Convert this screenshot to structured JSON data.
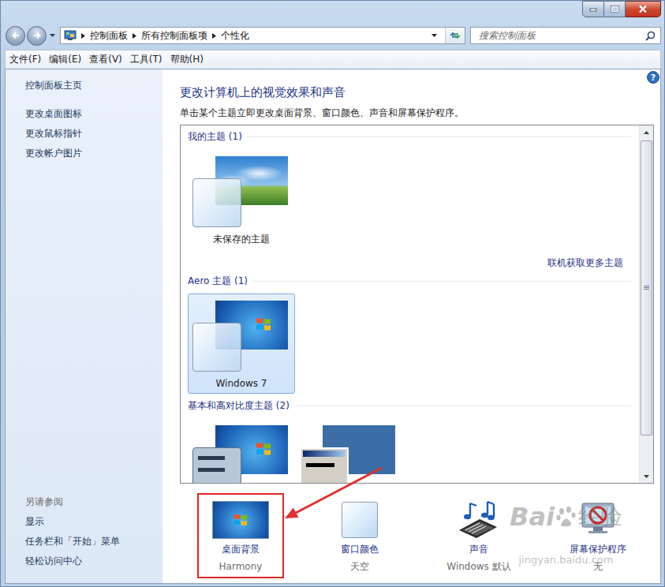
{
  "address_bar": {
    "breadcrumb": [
      "控制面板",
      "所有控制面板项",
      "个性化"
    ]
  },
  "search": {
    "placeholder": "搜索控制面板"
  },
  "menu": [
    "文件(F)",
    "编辑(E)",
    "查看(V)",
    "工具(T)",
    "帮助(H)"
  ],
  "sidebar": {
    "items": [
      "控制面板主页",
      "更改桌面图标",
      "更改鼠标指针",
      "更改帐户图片"
    ],
    "see_also_title": "另请参阅",
    "see_also": [
      "显示",
      "任务栏和「开始」菜单",
      "轻松访问中心"
    ]
  },
  "content": {
    "title": "更改计算机上的视觉效果和声音",
    "description": "单击某个主题立即更改桌面背景、窗口颜色、声音和屏幕保护程序。",
    "help": "?"
  },
  "theme_groups": [
    {
      "title": "我的主题 (1)",
      "themes": [
        {
          "name": "未保存的主题",
          "kind": "photo",
          "selected": false
        }
      ],
      "link": "联机获取更多主题"
    },
    {
      "title": "Aero 主题 (1)",
      "themes": [
        {
          "name": "Windows 7",
          "kind": "aero",
          "selected": true
        }
      ]
    },
    {
      "title": "基本和高对比度主题 (2)",
      "themes": [
        {
          "kind": "basic",
          "selected": false
        },
        {
          "kind": "classic",
          "selected": false
        }
      ]
    }
  ],
  "scrollbar": {
    "level": 0.9
  },
  "settings": [
    {
      "label": "桌面背景",
      "value": "Harmony",
      "kind": "background",
      "highlighted": true
    },
    {
      "label": "窗口颜色",
      "value": "天空",
      "kind": "color",
      "highlighted": false
    },
    {
      "label": "声音",
      "value": "Windows 默认",
      "kind": "sound",
      "highlighted": false
    },
    {
      "label": "屏幕保护程序",
      "value": "无",
      "kind": "screensaver",
      "highlighted": false
    }
  ],
  "annotation": {
    "arrow": true
  },
  "watermark": {
    "brand": "Bai",
    "brand_cn": "经验",
    "url": "jingyan.baidu.com"
  }
}
